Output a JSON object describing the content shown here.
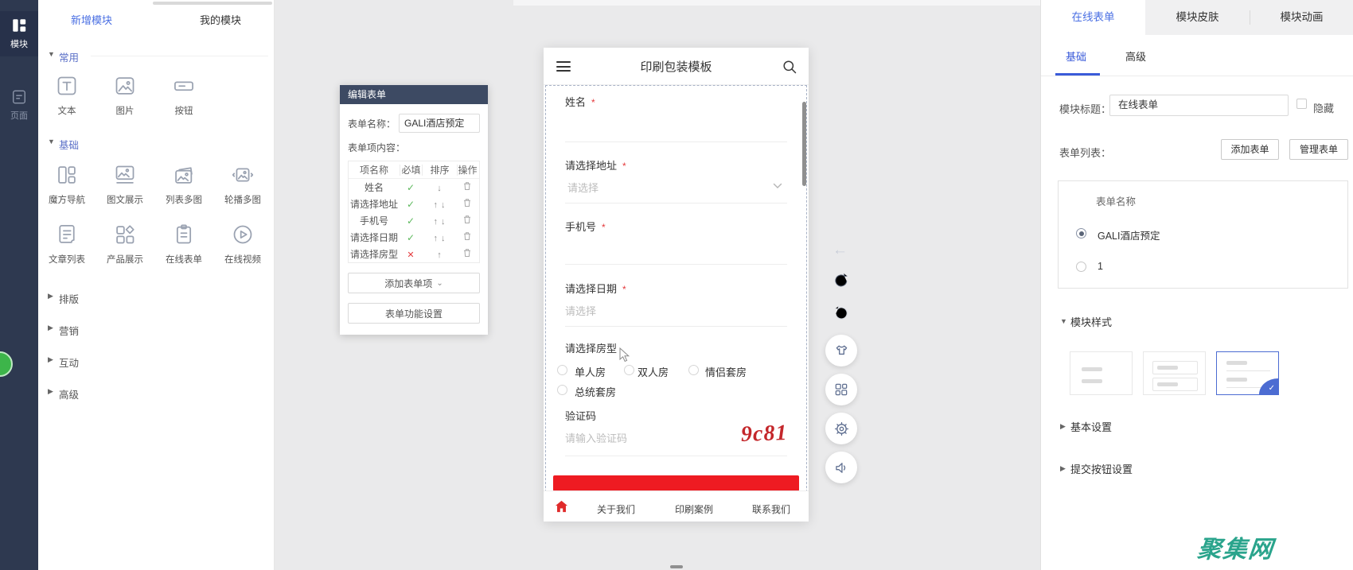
{
  "colors": {
    "accent_blue": "#4a6fe3",
    "submit_red": "#ee1b22",
    "watermark_green": "#2aa48c",
    "check_green": "#5cb85c",
    "cross_red": "#e4393c"
  },
  "nav_rail": {
    "items": [
      {
        "label": "模块"
      },
      {
        "label": "页面"
      }
    ]
  },
  "module_panel": {
    "tabs": [
      {
        "label": "新增模块"
      },
      {
        "label": "我的模块"
      }
    ],
    "sections": [
      {
        "label": "常用"
      },
      {
        "label": "基础"
      },
      {
        "label": "排版"
      },
      {
        "label": "营销"
      },
      {
        "label": "互动"
      },
      {
        "label": "高级"
      }
    ],
    "common_items": [
      {
        "label": "文本"
      },
      {
        "label": "图片"
      },
      {
        "label": "按钮"
      }
    ],
    "basic_items": [
      {
        "label": "魔方导航"
      },
      {
        "label": "图文展示"
      },
      {
        "label": "列表多图"
      },
      {
        "label": "轮播多图"
      },
      {
        "label": "文章列表"
      },
      {
        "label": "产品展示"
      },
      {
        "label": "在线表单"
      },
      {
        "label": "在线视频"
      }
    ]
  },
  "edit_form_panel": {
    "title": "编辑表单",
    "form_name_label": "表单名称：",
    "form_name_value": "GALI酒店预定",
    "items_label": "表单项内容：",
    "table_headers": [
      "项名称",
      "必填",
      "排序",
      "操作"
    ],
    "rows": [
      {
        "name": "姓名"
      },
      {
        "name": "请选择地址"
      },
      {
        "name": "手机号"
      },
      {
        "name": "请选择日期"
      },
      {
        "name": "请选择房型"
      }
    ],
    "add_item_button": "添加表单项",
    "function_settings_button": "表单功能设置"
  },
  "phone": {
    "title": "印刷包装模板",
    "required_mark": "*",
    "fields": {
      "name_label": "姓名",
      "address_label": "请选择地址",
      "address_placeholder": "请选择",
      "phone_label": "手机号",
      "date_label": "请选择日期",
      "date_placeholder": "请选择",
      "room_label": "请选择房型",
      "room_options": [
        {
          "label": "单人房"
        },
        {
          "label": "双人房"
        },
        {
          "label": "情侣套房"
        },
        {
          "label": "总统套房"
        }
      ],
      "captcha_label": "验证码",
      "captcha_placeholder": "请输入验证码",
      "captcha_value": "9c81"
    },
    "footer_links": [
      {
        "label": "关于我们"
      },
      {
        "label": "印刷案例"
      },
      {
        "label": "联系我们"
      }
    ]
  },
  "settings_panel": {
    "tabs": [
      {
        "label": "在线表单"
      },
      {
        "label": "模块皮肤"
      },
      {
        "label": "模块动画"
      }
    ],
    "sub_tabs": [
      {
        "label": "基础"
      },
      {
        "label": "高级"
      }
    ],
    "module_title_label": "模块标题：",
    "module_title_value": "在线表单",
    "hide_label": "隐藏",
    "form_list_label": "表单列表：",
    "add_form_button": "添加表单",
    "manage_form_button": "管理表单",
    "form_list_header": "表单名称",
    "form_options": [
      {
        "label": "GALI酒店预定"
      },
      {
        "label": "1"
      }
    ],
    "module_style_label": "模块样式",
    "basic_settings_label": "基本设置",
    "submit_settings_label": "提交按钮设置"
  },
  "watermark": "聚集网"
}
